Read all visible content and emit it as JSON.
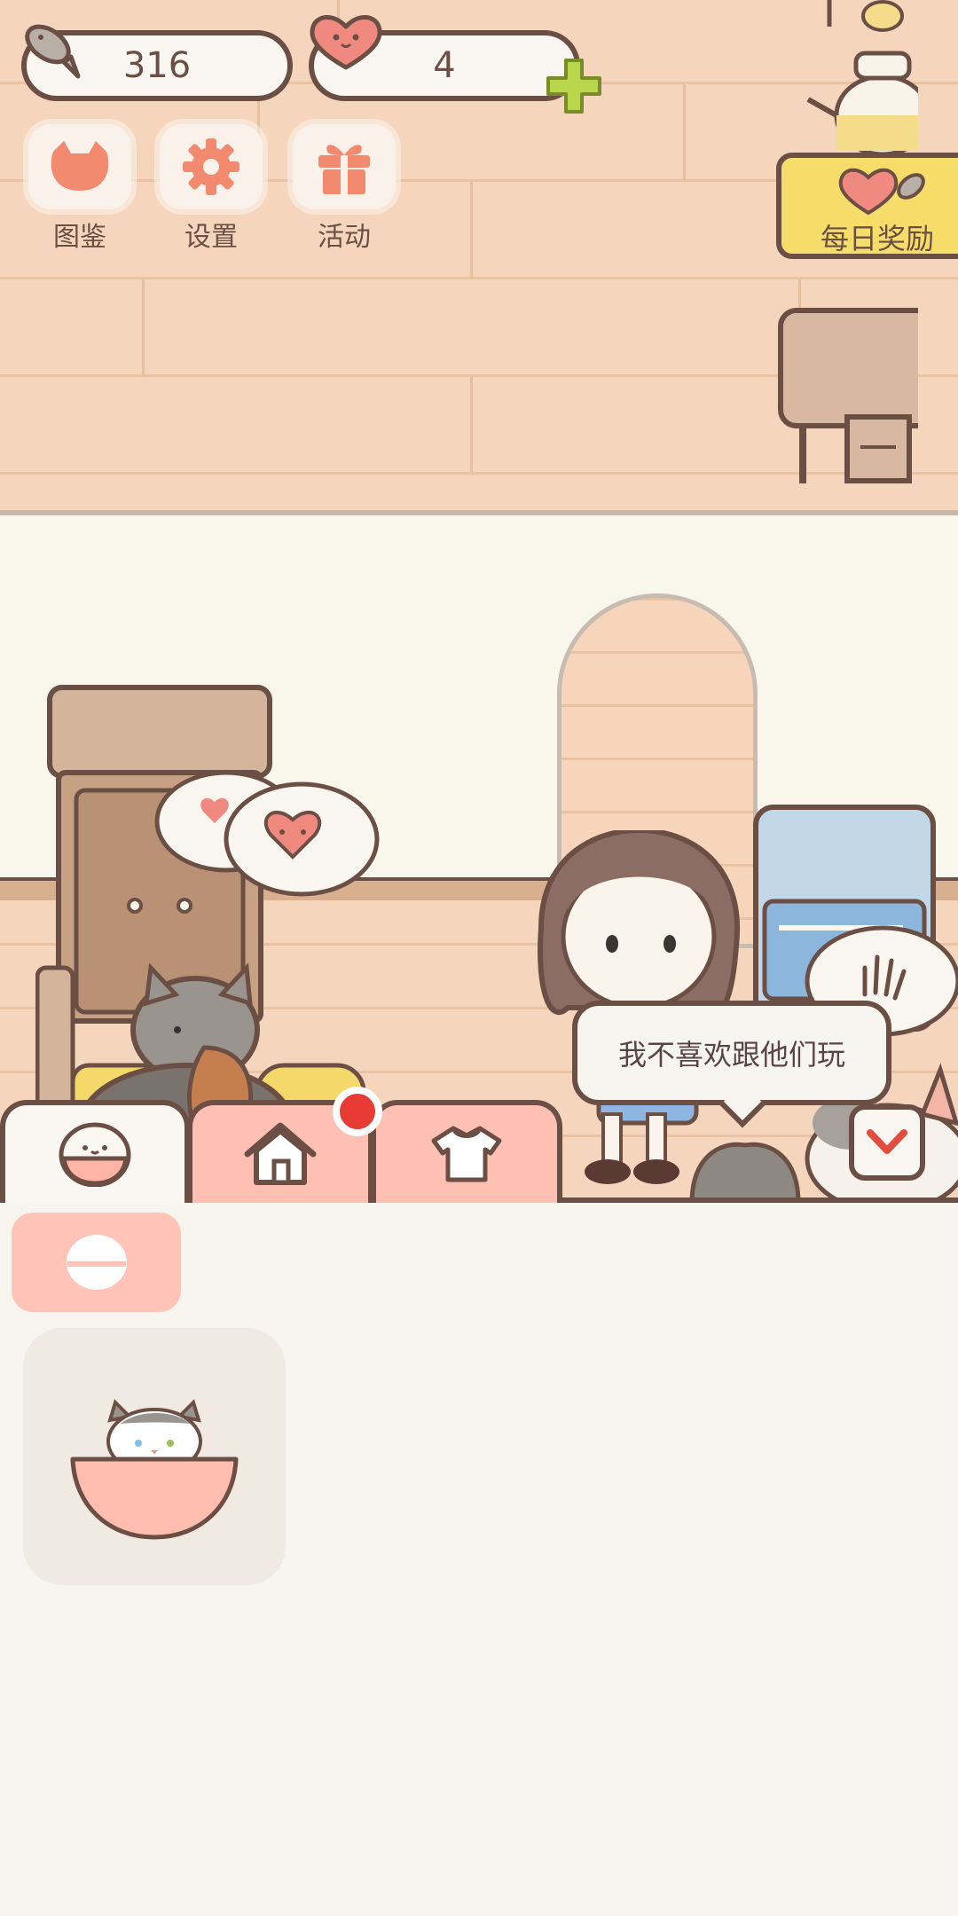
{
  "hud": {
    "fish_count": "316",
    "heart_count": "4"
  },
  "top_buttons": [
    {
      "label": "图鉴",
      "icon": "cat-face-icon"
    },
    {
      "label": "设置",
      "icon": "gear-icon"
    },
    {
      "label": "活动",
      "icon": "gift-icon"
    }
  ],
  "daily_reward": {
    "label": "每日奖励"
  },
  "dialog": {
    "text": "我不喜欢跟他们玩"
  },
  "tabs": [
    {
      "name": "cat-bowl-tab",
      "active": true
    },
    {
      "name": "house-tab",
      "active": false,
      "notification": true
    },
    {
      "name": "clothes-tab",
      "active": false
    }
  ],
  "colors": {
    "outline": "#6b4f45",
    "accent_pink": "#ffc0b4",
    "coral": "#f08a72",
    "notification_red": "#e83b35",
    "reward_yellow": "#f6dd6a"
  }
}
